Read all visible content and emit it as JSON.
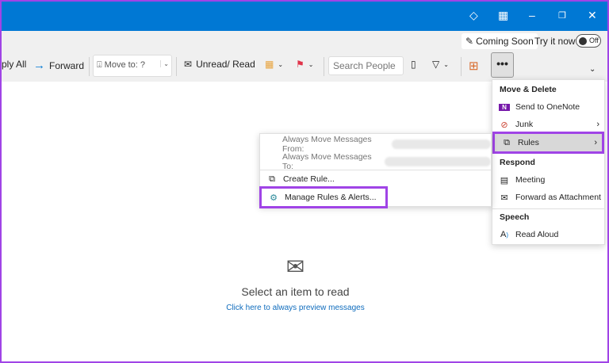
{
  "titlebar": {
    "icons": [
      "diamond-icon",
      "qr-icon",
      "minimize-icon",
      "restore-icon",
      "close-icon"
    ]
  },
  "banner": {
    "coming_soon": "Coming Soon",
    "try_now": "Try it now",
    "toggle": "Off"
  },
  "toolbar": {
    "reply_all": "ply All",
    "forward": "Forward",
    "move_to": "Move to: ?",
    "unread_read": "Unread/ Read",
    "search_placeholder": "Search People",
    "more": "•••"
  },
  "more_menu": {
    "sections": [
      {
        "header": "Move & Delete",
        "items": [
          "Send to OneNote",
          "Junk",
          "Rules"
        ]
      },
      {
        "header": "Respond",
        "items": [
          "Meeting",
          "Forward as Attachment"
        ]
      },
      {
        "header": "Speech",
        "items": [
          "Read Aloud"
        ]
      }
    ]
  },
  "rules_menu": {
    "items": [
      "Always Move Messages From:",
      "Always Move Messages To:",
      "Create Rule...",
      "Manage Rules & Alerts..."
    ]
  },
  "reading_pane": {
    "title": "Select an item to read",
    "link": "Click here to always preview messages"
  },
  "colors": {
    "titlebar": "#0078d4",
    "highlight": "#a044e6"
  }
}
